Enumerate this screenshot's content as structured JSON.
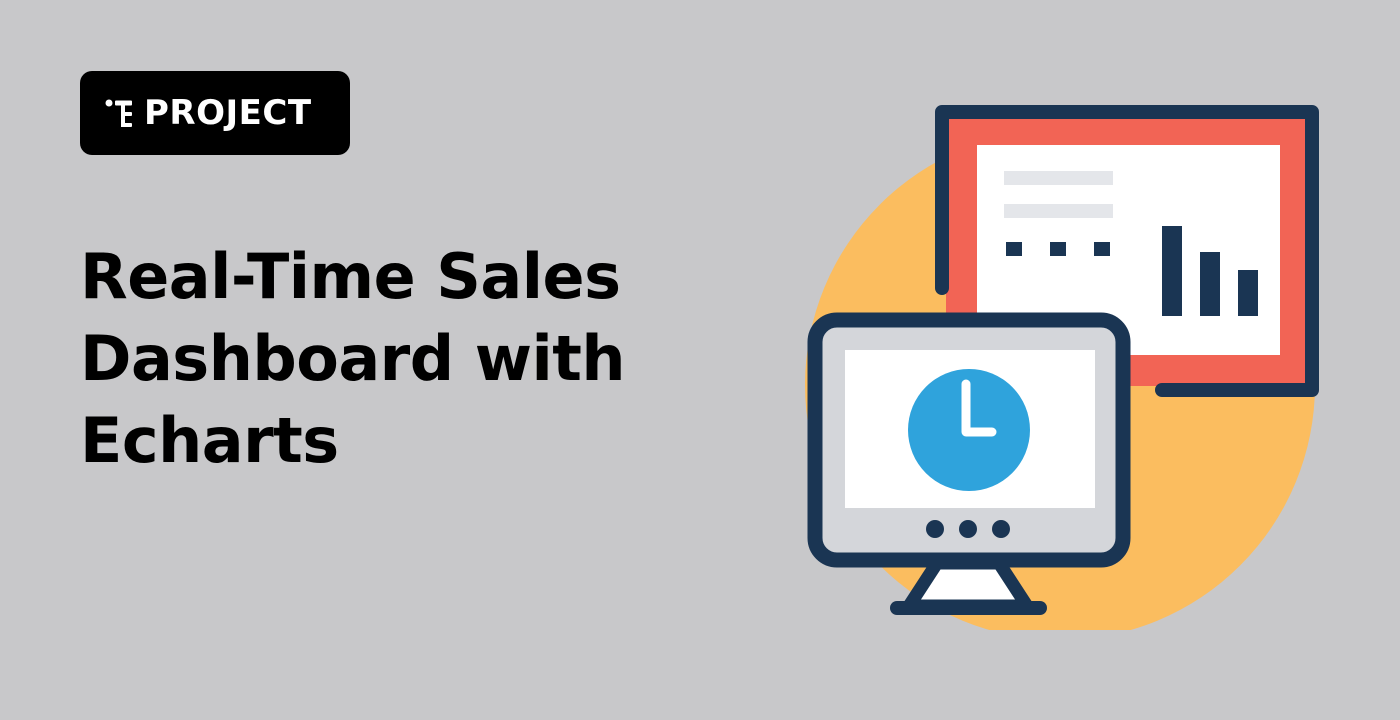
{
  "badge": {
    "label": "PROJECT",
    "icon": "project-tree-icon"
  },
  "title": {
    "lines": [
      "Real-Time Sales",
      "Dashboard with",
      "Echarts"
    ]
  },
  "illustration": {
    "icons": [
      "presentation-board-icon",
      "bar-chart-icon",
      "monitor-icon",
      "clock-icon"
    ]
  },
  "colors": {
    "background": "#c8c8ca",
    "badge_background": "#000000",
    "accent_yellow": "#fbbd5f",
    "accent_red": "#f26455",
    "navy": "#1a3553",
    "clock_blue": "#2fa3dc",
    "screen_gray": "#d4d6da",
    "panel_white": "#ffffff",
    "line_gray": "#e4e6ea"
  }
}
